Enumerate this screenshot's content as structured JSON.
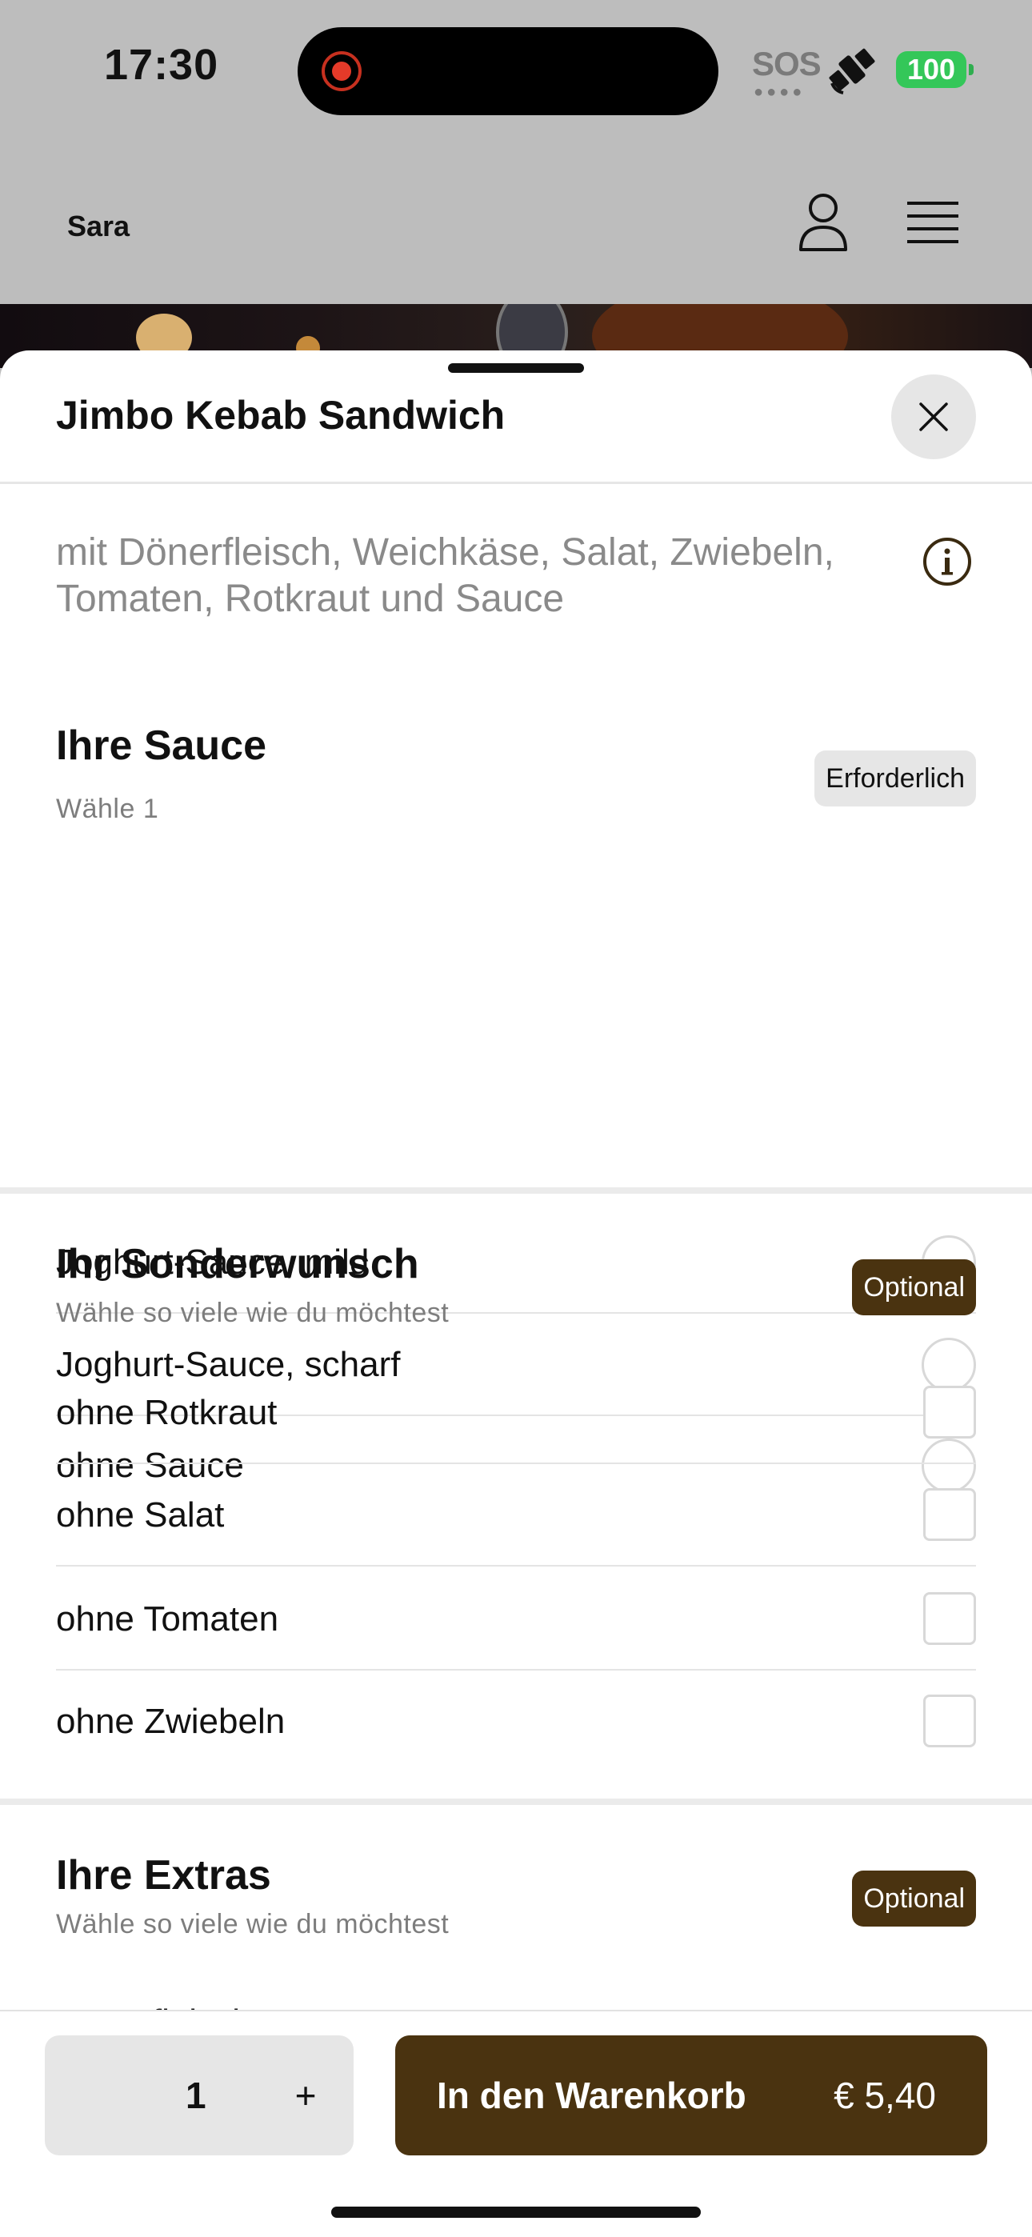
{
  "status_bar": {
    "time": "17:30",
    "sos_label": "SOS",
    "battery_level": "100",
    "icons": [
      "record-icon",
      "sos-icon",
      "satellite-icon",
      "battery-icon"
    ]
  },
  "app_header": {
    "restaurant_name": "Sara",
    "icons": [
      "user-icon",
      "menu-icon"
    ]
  },
  "sheet": {
    "title": "Jimbo Kebab Sandwich",
    "description": "mit Dönerfleisch, Weichkäse, Salat, Zwiebeln, Tomaten, Rotkraut und Sauce",
    "icons": [
      "close-icon",
      "info-icon"
    ]
  },
  "sections": {
    "sauce": {
      "title": "Ihre Sauce",
      "subtitle": "Wähle 1",
      "badge": "Erforderlich",
      "options": [
        "Joghurt-Sauce, mild",
        "Joghurt-Sauce, scharf",
        "ohne Sauce"
      ]
    },
    "sonderwunsch": {
      "title": "Ihr Sonderwunsch",
      "subtitle": "Wähle so viele wie du möchtest",
      "badge": "Optional",
      "options": [
        "ohne Rotkraut",
        "ohne Salat",
        "ohne Tomaten",
        "ohne Zwiebeln"
      ]
    },
    "extras": {
      "title": "Ihre Extras",
      "subtitle": "Wähle so viele wie du möchtest",
      "badge": "Optional",
      "options": [
        "Dönerfleisch"
      ]
    }
  },
  "bottom_bar": {
    "quantity": "1",
    "plus_label": "+",
    "add_to_cart_label": "In den Warenkorb",
    "price": "€ 5,40"
  },
  "colors": {
    "accent_brown": "#4a3310",
    "badge_grey": "#e6e6e6",
    "battery_green": "#34c759",
    "dim_overlay": "#bdbdbd"
  }
}
